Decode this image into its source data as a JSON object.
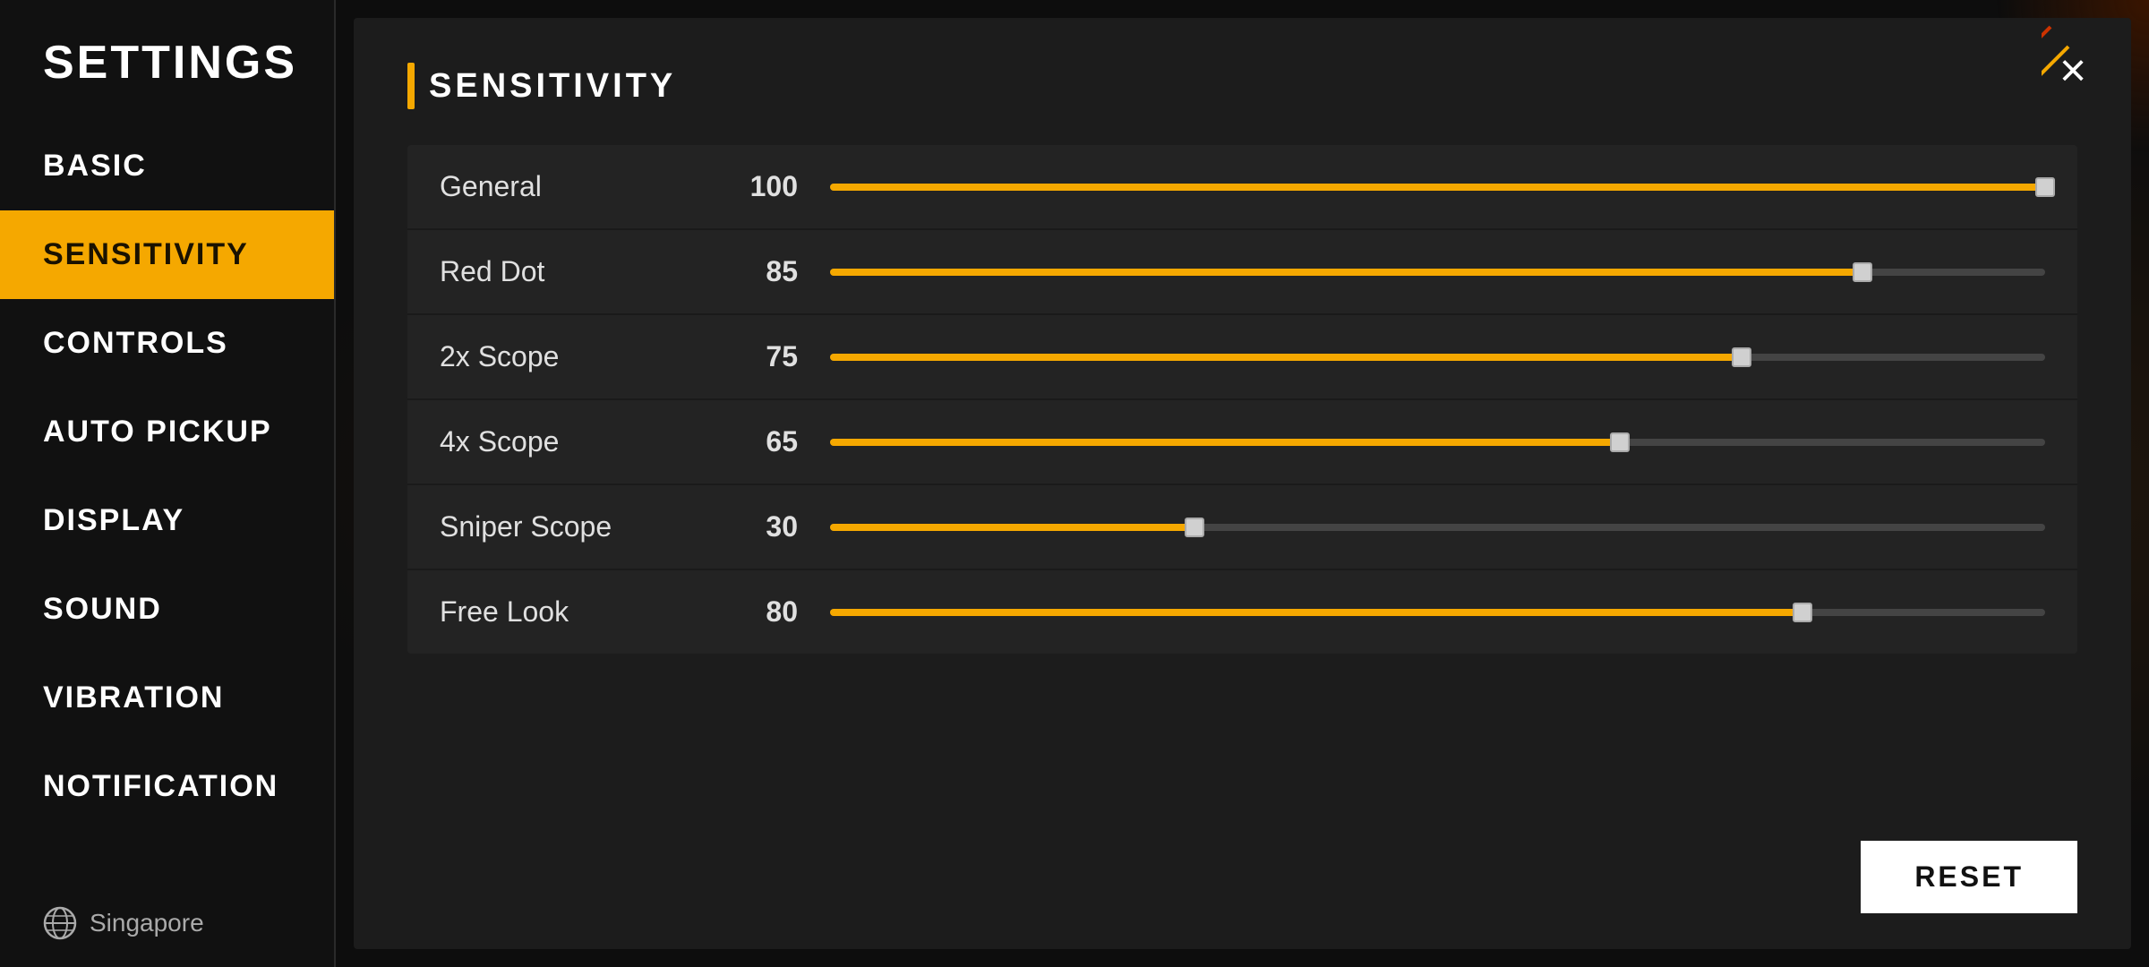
{
  "app": {
    "title": "SETTINGS"
  },
  "sidebar": {
    "items": [
      {
        "id": "basic",
        "label": "BASIC",
        "active": false
      },
      {
        "id": "sensitivity",
        "label": "SENSITIVITY",
        "active": true
      },
      {
        "id": "controls",
        "label": "CONTROLS",
        "active": false
      },
      {
        "id": "auto-pickup",
        "label": "AUTO PICKUP",
        "active": false
      },
      {
        "id": "display",
        "label": "DISPLAY",
        "active": false
      },
      {
        "id": "sound",
        "label": "SOUND",
        "active": false
      },
      {
        "id": "vibration",
        "label": "VIBRATION",
        "active": false
      },
      {
        "id": "notification",
        "label": "NOTIFICATION",
        "active": false
      }
    ],
    "region": "Singapore"
  },
  "section": {
    "title": "SENSITIVITY"
  },
  "sliders": [
    {
      "label": "General",
      "value": 100,
      "max": 100
    },
    {
      "label": "Red Dot",
      "value": 85,
      "max": 100
    },
    {
      "label": "2x Scope",
      "value": 75,
      "max": 100
    },
    {
      "label": "4x Scope",
      "value": 65,
      "max": 100
    },
    {
      "label": "Sniper Scope",
      "value": 30,
      "max": 100
    },
    {
      "label": "Free Look",
      "value": 80,
      "max": 100
    }
  ],
  "buttons": {
    "reset": "RESET",
    "close": "×"
  },
  "colors": {
    "accent": "#f5a800",
    "active_nav_bg": "#f5a800",
    "active_nav_text": "#1a1200",
    "track_bg": "#444444",
    "track_fill": "#f5a800",
    "thumb": "#d0d0d0"
  }
}
